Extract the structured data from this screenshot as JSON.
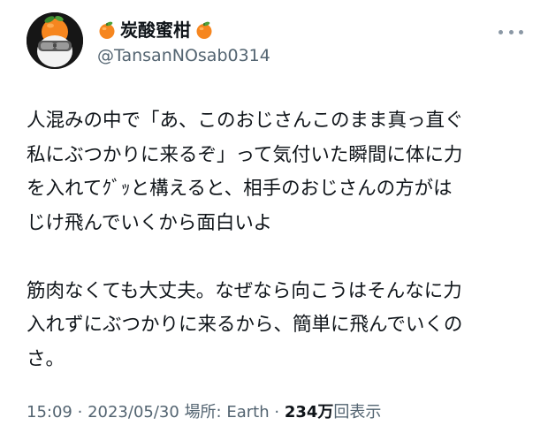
{
  "user": {
    "display_name": "炭酸蜜柑",
    "handle": "@TansanNOsab0314",
    "name_emoji": "tangerine-emoji"
  },
  "tweet": {
    "paragraph1": "人混みの中で「あ、このおじさんこのまま真っ直ぐ\n私にぶつかりに来るぞ」って気付いた瞬間に体に力\nを入れてｸﾞｯと構えると、相手のおじさんの方がは\nじけ飛んでいくから面白いよ",
    "paragraph2": "筋肉なくても大丈夫。なぜなら向こうはそんなに力\n入れずにぶつかりに来るから、簡単に飛んでいくの\nさ。"
  },
  "meta": {
    "time": "15:09",
    "separator": "·",
    "date": "2023/05/30",
    "location_label": "場所: Earth",
    "views_count": "234万",
    "views_label": "回表示"
  },
  "icons": {
    "more": "more-horizontal-icon"
  },
  "colors": {
    "text_primary": "#0f1419",
    "text_secondary": "#536471",
    "orange": "#f6861f"
  }
}
